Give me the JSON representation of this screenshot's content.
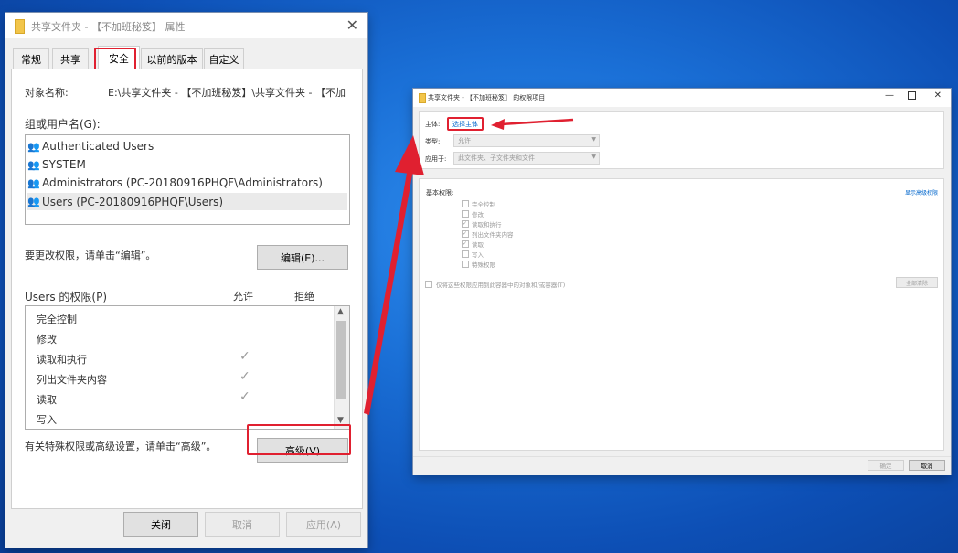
{
  "props_window": {
    "title": "共享文件夹 - 【不加班秘笈】 属性",
    "tabs": [
      "常规",
      "共享",
      "安全",
      "以前的版本",
      "自定义"
    ],
    "active_tab": "安全",
    "object_label": "对象名称:",
    "object_value": "E:\\共享文件夹 - 【不加班秘笈】\\共享文件夹 - 【不加",
    "groups_label": "组或用户名(G):",
    "users": [
      "Authenticated Users",
      "SYSTEM",
      "Administrators (PC-20180916PHQF\\Administrators)",
      "Users (PC-20180916PHQF\\Users)"
    ],
    "edit_hint": "要更改权限，请单击“编辑”。",
    "edit_button": "编辑(E)...",
    "perm_label": "Users 的权限(P)",
    "allow_label": "允许",
    "deny_label": "拒绝",
    "perms": [
      {
        "name": "完全控制",
        "allow": false
      },
      {
        "name": "修改",
        "allow": false
      },
      {
        "name": "读取和执行",
        "allow": true
      },
      {
        "name": "列出文件夹内容",
        "allow": true
      },
      {
        "name": "读取",
        "allow": true
      },
      {
        "name": "写入",
        "allow": false
      }
    ],
    "advanced_hint": "有关特殊权限或高级设置，请单击“高级”。",
    "advanced_button": "高级(V)",
    "close_button": "关闭",
    "cancel_button": "取消",
    "apply_button": "应用(A)"
  },
  "perm_entry_window": {
    "title": "共享文件夹 - 【不加班秘笈】 的权限项目",
    "principal_label": "主体:",
    "principal_link": "选择主体",
    "type_label": "类型:",
    "type_value": "允许",
    "applies_label": "应用于:",
    "applies_value": "此文件夹、子文件夹和文件",
    "basic_label": "基本权限:",
    "show_advanced": "显示高级权限",
    "perms": [
      {
        "name": "完全控制",
        "checked": false
      },
      {
        "name": "修改",
        "checked": false
      },
      {
        "name": "读取和执行",
        "checked": true
      },
      {
        "name": "列出文件夹内容",
        "checked": true
      },
      {
        "name": "读取",
        "checked": true
      },
      {
        "name": "写入",
        "checked": false
      },
      {
        "name": "特殊权限",
        "checked": false
      }
    ],
    "only_apply_label": "仅将这些权限应用到此容器中的对象和/或容器(T)",
    "clear_all_button": "全部清除",
    "ok_button": "确定",
    "cancel_button": "取消"
  },
  "colors": {
    "highlight": "#e02030",
    "link": "#0066cc",
    "desktop": "#1a6fd6"
  }
}
